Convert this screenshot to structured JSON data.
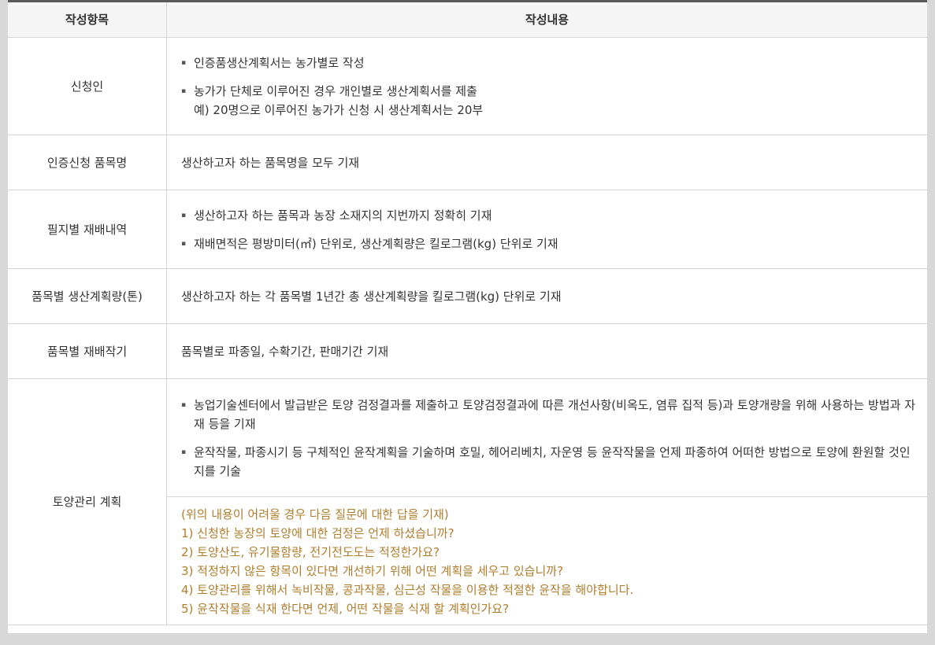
{
  "header": {
    "col1": "작성항목",
    "col2": "작성내용"
  },
  "rows": [
    {
      "label": "신청인",
      "items": [
        "인증품생산계획서는 농가별로 작성",
        "농가가 단체로 이루어진 경우 개인별로 생산계획서를 제출"
      ],
      "note": "예) 20명으로 이루어진 농가가 신청 시 생산계획서는 20부"
    },
    {
      "label": "인증신청 품목명",
      "text": "생산하고자 하는 품목명을 모두 기재"
    },
    {
      "label": "필지별 재배내역",
      "items": [
        "생산하고자 하는 품목과 농장 소재지의 지번까지 정확히 기재",
        "재배면적은 평방미터(㎡) 단위로, 생산계획량은 킬로그램(kg) 단위로 기재"
      ]
    },
    {
      "label": "품목별 생산계획량(톤)",
      "text": "생산하고자 하는 각 품목별 1년간 총 생산계획량을 킬로그램(kg) 단위로 기재"
    },
    {
      "label": "품목별 재배작기",
      "text": "품목별로 파종일, 수확기간, 판매기간 기재"
    },
    {
      "label": "토양관리 계획",
      "items": [
        "농업기술센터에서 발급받은 토양 검정결과를 제출하고 토양검정결과에 따른 개선사항(비옥도, 염류 집적 등)과 토양개량을 위해 사용하는 방법과 자재 등을 기재",
        "윤작작물, 파종시기 등 구체적인 윤작계획을 기술하며 호밀, 헤어리베치, 자운영 등 윤작작물을 언제 파종하여 어떠한 방법으로 토양에 환원할 것인지를 기술"
      ],
      "questions": [
        "(위의 내용이 어려울 경우 다음 질문에 대한 답을 기재)",
        "1) 신청한 농장의 토양에 대한 검정은 언제 하셨습니까?",
        "2) 토양산도, 유기물함량, 전기전도도는 적정한가요?",
        "3) 적정하지 않은 항목이 있다면 개선하기 위해 어떤 계획을 세우고 있습니까?",
        "4) 토양관리를 위해서 녹비작물, 콩과작물, 심근성 작물을 이용한 적절한 윤작을 해야합니다.",
        "5) 윤작작물을 식재 한다면 언제, 어떤 작물을 식재 할 계획인가요?"
      ]
    }
  ]
}
